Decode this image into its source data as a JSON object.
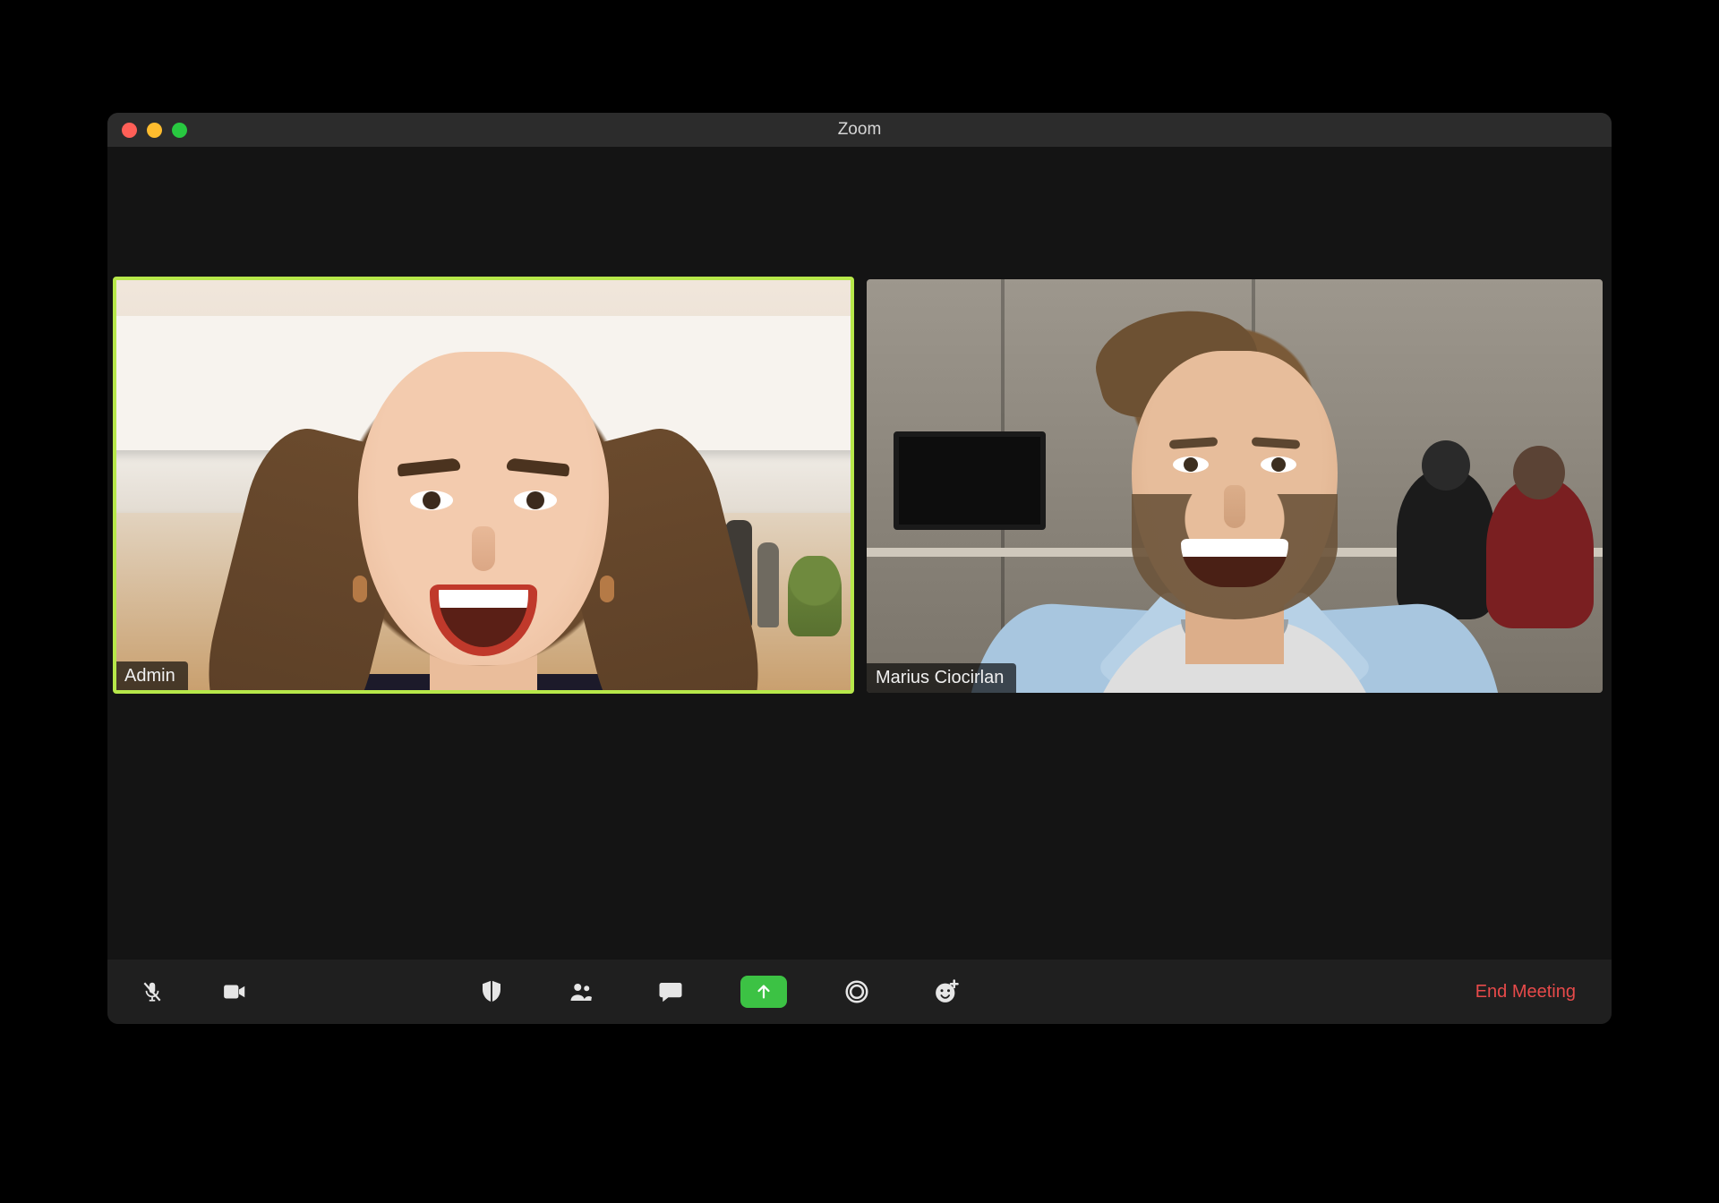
{
  "window": {
    "title": "Zoom"
  },
  "participants": [
    {
      "name": "Admin",
      "active": true
    },
    {
      "name": "Marius Ciocirlan",
      "active": false
    }
  ],
  "toolbar": {
    "mute_label": "Mute",
    "video_label": "Stop Video",
    "security_label": "Security",
    "participants_label": "Participants",
    "chat_label": "Chat",
    "share_label": "Share Screen",
    "record_label": "Record",
    "reactions_label": "Reactions",
    "end_label": "End Meeting"
  },
  "colors": {
    "active_border": "#b7e84a",
    "share_accent": "#3cc244",
    "end_text": "#e74a4a"
  }
}
